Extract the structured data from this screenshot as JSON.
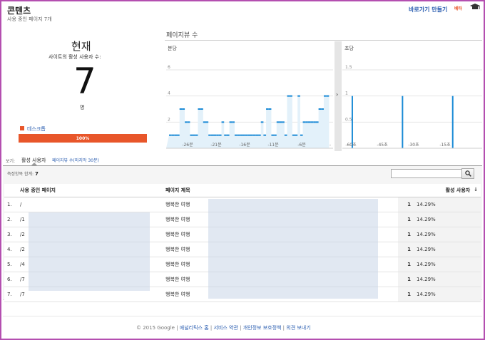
{
  "header": {
    "title": "콘텐츠",
    "subtitle": "사용 중인 페이지 7개",
    "shortcut_label": "바로가기 만들기",
    "beta_label": "베타"
  },
  "realtime": {
    "now_label": "현재",
    "active_users_label": "사이트의 활성 사용자 수:",
    "active_users": "7",
    "unit": "명",
    "device_label": "데스크톱",
    "device_pct_text": "100%",
    "device_fraction": 1.0
  },
  "pageviews": {
    "title": "페이지뷰 수",
    "minute_panel_label": "분당",
    "second_panel_label": "초당"
  },
  "chart_data": [
    {
      "type": "bar",
      "title": "분당",
      "ylim": [
        0,
        6
      ],
      "y_ticks": [
        "2",
        "4",
        "6"
      ],
      "x_ticks": [
        "-26분",
        "-21분",
        "-16분",
        "-11분",
        "-6분",
        "-"
      ],
      "values": [
        1,
        1,
        1,
        1,
        3,
        3,
        2,
        2,
        1,
        1,
        1,
        3,
        3,
        2,
        2,
        1,
        1,
        1,
        1,
        1,
        2,
        1,
        1,
        2,
        2,
        1,
        1,
        1,
        1,
        1,
        1,
        1,
        1,
        1,
        1,
        2,
        1,
        3,
        3,
        1,
        1,
        2,
        2,
        2,
        1,
        4,
        4,
        1,
        1,
        4,
        1,
        2,
        2,
        2,
        2,
        2,
        2,
        3,
        3,
        4,
        4,
        0
      ]
    },
    {
      "type": "bar",
      "title": "초당",
      "ylim": [
        0,
        1.5
      ],
      "y_ticks": [
        "0.5",
        "1",
        "1.5"
      ],
      "x_ticks": [
        "-60초",
        "-45초",
        "-30초",
        "-15초"
      ],
      "spikes_at_seconds_ago": [
        -59,
        -35,
        -11
      ],
      "spike_value": 1
    }
  ],
  "tabs": {
    "view_label": "보기:",
    "active": "활성 사용자",
    "other": "페이지뷰 수(마지막 30분)"
  },
  "table": {
    "metric_label": "측정항목 합계:",
    "metric_total": "7",
    "headers": [
      "사용 중인 페이지",
      "페이지 제목",
      "활성 사용자"
    ],
    "rows": [
      {
        "n": "1.",
        "page": "/",
        "title": "행복한 여행",
        "count": "1",
        "pct": "14.29%"
      },
      {
        "n": "2.",
        "page": "/1",
        "title": "행복한 여행",
        "count": "1",
        "pct": "14.29%"
      },
      {
        "n": "3.",
        "page": "/2",
        "title": "행복한 여행",
        "count": "1",
        "pct": "14.29%"
      },
      {
        "n": "4.",
        "page": "/2",
        "title": "행복한 여행",
        "count": "1",
        "pct": "14.29%"
      },
      {
        "n": "5.",
        "page": "/4",
        "title": "행복한 여행",
        "count": "1",
        "pct": "14.29%"
      },
      {
        "n": "6.",
        "page": "/7",
        "title": "행복한 여행",
        "count": "1",
        "pct": "14.29%"
      },
      {
        "n": "7.",
        "page": "/7",
        "title": "행복한 여행",
        "count": "1",
        "pct": "14.29%"
      }
    ]
  },
  "footer": {
    "copyright": "© 2015 Google",
    "links": [
      "애널리틱스 홈",
      "서비스 약관",
      "개인정보 보호정책",
      "의견 보내기"
    ]
  },
  "colors": {
    "accent": "#e8562a",
    "link": "#2a5db0",
    "chart_bar": "#1a8ad6",
    "frame": "#b44fb0"
  }
}
